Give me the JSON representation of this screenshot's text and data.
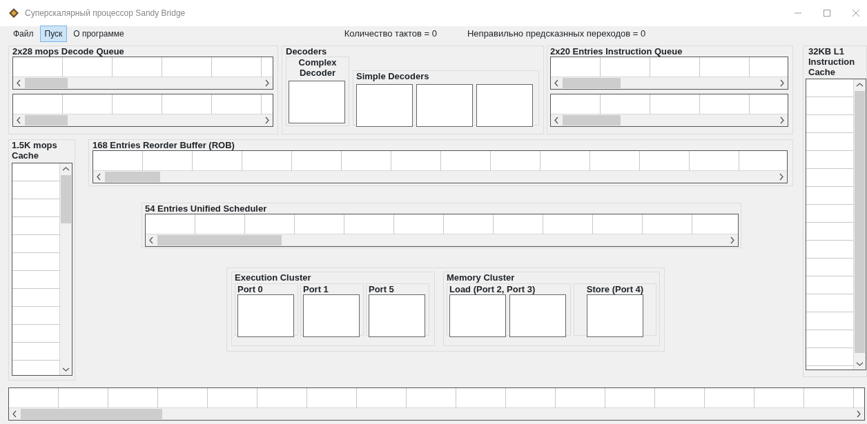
{
  "window": {
    "title": "Суперскалярный процессор Sandy Bridge"
  },
  "menu": [
    {
      "label": "Файл",
      "selected": false
    },
    {
      "label": "Пуск",
      "selected": true
    },
    {
      "label": "О программе",
      "selected": false
    }
  ],
  "counters": [
    "Количество тактов = 0",
    "Неправильно предсказнных переходов = 0"
  ],
  "decode_queue": {
    "title": "2x28 mops Decode Queue"
  },
  "decoders": {
    "title": "Decoders",
    "complex": "Complex Decoder",
    "simple": "Simple Decoders"
  },
  "instruction_queue": {
    "title": "2x20 Entries Instruction Queue"
  },
  "l1_cache": {
    "title": "32KB L1 Instruction Cache"
  },
  "mops_cache": {
    "title": "1.5K mops Cache"
  },
  "reorder_buffer": {
    "title": "168 Entries Reorder Buffer (ROB)"
  },
  "scheduler": {
    "title": "54 Entries Unified Scheduler"
  },
  "execution_cluster": {
    "title": "Execution Cluster",
    "ports": [
      "Port 0",
      "Port 1",
      "Port 5"
    ]
  },
  "memory_cluster": {
    "title": "Memory Cluster",
    "load": "Load (Port 2, Port 3)",
    "store": "Store (Port 4)"
  }
}
